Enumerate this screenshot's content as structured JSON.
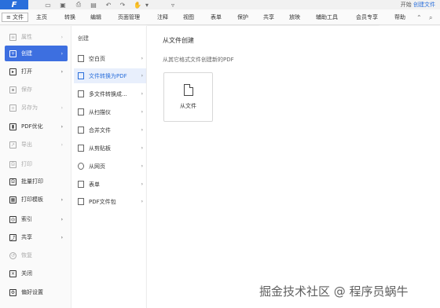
{
  "titlebar": {
    "logo": "F",
    "quick_access": [
      "open",
      "save",
      "print",
      "save-as",
      "undo",
      "redo",
      "hand",
      "dropdown"
    ],
    "login_text": "开始",
    "login_link": "创建文件"
  },
  "menubar": {
    "file_tab": "≡ 文件",
    "items": [
      "主页",
      "转换",
      "编辑",
      "页面管理",
      "注释",
      "视图",
      "表单",
      "保护",
      "共享",
      "放映",
      "辅助工具",
      "会员专享",
      "帮助"
    ]
  },
  "sidebar": {
    "items": [
      {
        "label": "属性",
        "icon": "properties-icon",
        "arrow": "›",
        "disabled": true
      },
      {
        "label": "创建",
        "icon": "create-icon",
        "arrow": "›",
        "active": true
      },
      {
        "label": "打开",
        "icon": "open-icon",
        "arrow": "›"
      },
      {
        "label": "保存",
        "icon": "save-icon",
        "disabled": true
      },
      {
        "label": "另存为",
        "icon": "save-as-icon",
        "arrow": "›",
        "disabled": true
      },
      {
        "label": "PDF优化",
        "icon": "optimize-icon",
        "arrow": "›"
      },
      {
        "label": "导出",
        "icon": "export-icon",
        "arrow": "›",
        "disabled": true
      },
      {
        "label": "打印",
        "icon": "print-icon",
        "disabled": true
      },
      {
        "label": "批量打印",
        "icon": "batch-print-icon"
      },
      {
        "label": "打印模板",
        "icon": "print-template-icon",
        "arrow": "›"
      },
      {
        "label": "索引",
        "icon": "index-icon",
        "arrow": "›"
      },
      {
        "label": "共享",
        "icon": "share-icon",
        "arrow": "›"
      },
      {
        "label": "恢复",
        "icon": "restore-icon",
        "disabled": true
      },
      {
        "label": "关闭",
        "icon": "close-icon"
      },
      {
        "label": "偏好设置",
        "icon": "preferences-icon"
      }
    ]
  },
  "submenu": {
    "title": "创建",
    "items": [
      {
        "label": "空白页",
        "icon": "blank-page-icon"
      },
      {
        "label": "文件转换为PDF",
        "icon": "file-to-pdf-icon",
        "active": true
      },
      {
        "label": "多文件转换成...",
        "icon": "multi-file-icon"
      },
      {
        "label": "从扫描仪",
        "icon": "scanner-icon"
      },
      {
        "label": "合并文件",
        "icon": "merge-icon"
      },
      {
        "label": "从剪贴板",
        "icon": "clipboard-icon"
      },
      {
        "label": "从网页",
        "icon": "web-icon"
      },
      {
        "label": "表单",
        "icon": "form-icon"
      },
      {
        "label": "PDF文件包",
        "icon": "pdf-package-icon"
      }
    ]
  },
  "content": {
    "title": "从文件创建",
    "subtitle": "从其它格式文件创建新的PDF",
    "card_label": "从文件"
  },
  "watermark": "掘金技术社区 @ 程序员蜗牛",
  "colors": {
    "accent": "#3d6fe0",
    "logo": "#2a6fdb"
  }
}
